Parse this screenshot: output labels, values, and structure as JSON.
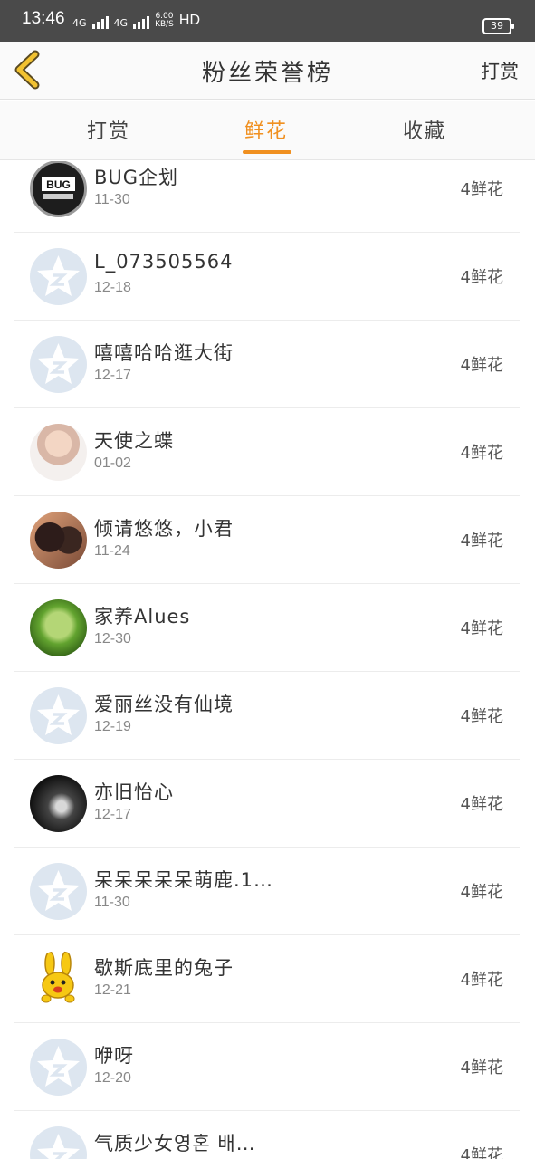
{
  "status_bar": {
    "time": "13:46",
    "network1": "4G",
    "network2": "4G",
    "speed_value": "6.00",
    "speed_unit": "KB/S",
    "hd": "HD",
    "battery": "39"
  },
  "header": {
    "title": "粉丝荣誉榜",
    "action_label": "打赏",
    "back_icon": "chevron-left-icon",
    "accent_color": "#f09020"
  },
  "tabs": [
    {
      "label": "打赏",
      "active": false
    },
    {
      "label": "鲜花",
      "active": true
    },
    {
      "label": "收藏",
      "active": false
    }
  ],
  "fans": [
    {
      "name": "BUG企划",
      "date": "11-30",
      "amount": "4鲜花",
      "avatar": "bug-logo-avatar"
    },
    {
      "name": "L_073505564",
      "date": "12-18",
      "amount": "4鲜花",
      "avatar": "default-star-avatar"
    },
    {
      "name": "嘻嘻哈哈逛大街",
      "date": "12-17",
      "amount": "4鲜花",
      "avatar": "default-star-avatar"
    },
    {
      "name": "天使之蝶",
      "date": "01-02",
      "amount": "4鲜花",
      "avatar": "photo-avatar"
    },
    {
      "name": "倾请悠悠，小君",
      "date": "11-24",
      "amount": "4鲜花",
      "avatar": "photo-avatar"
    },
    {
      "name": "家养Alues",
      "date": "12-30",
      "amount": "4鲜花",
      "avatar": "photo-avatar"
    },
    {
      "name": "爱丽丝没有仙境",
      "date": "12-19",
      "amount": "4鲜花",
      "avatar": "default-star-avatar"
    },
    {
      "name": "亦旧怡心",
      "date": "12-17",
      "amount": "4鲜花",
      "avatar": "photo-avatar"
    },
    {
      "name": "呆呆呆呆呆萌鹿.1…",
      "date": "11-30",
      "amount": "4鲜花",
      "avatar": "default-star-avatar"
    },
    {
      "name": "歇斯底里的兔子",
      "date": "12-21",
      "amount": "4鲜花",
      "avatar": "rabbit-avatar"
    },
    {
      "name": "咿呀",
      "date": "12-20",
      "amount": "4鲜花",
      "avatar": "default-star-avatar"
    },
    {
      "name": "气质少女영혼 배…",
      "date": "",
      "amount": "4鲜花",
      "avatar": "default-star-avatar"
    }
  ]
}
